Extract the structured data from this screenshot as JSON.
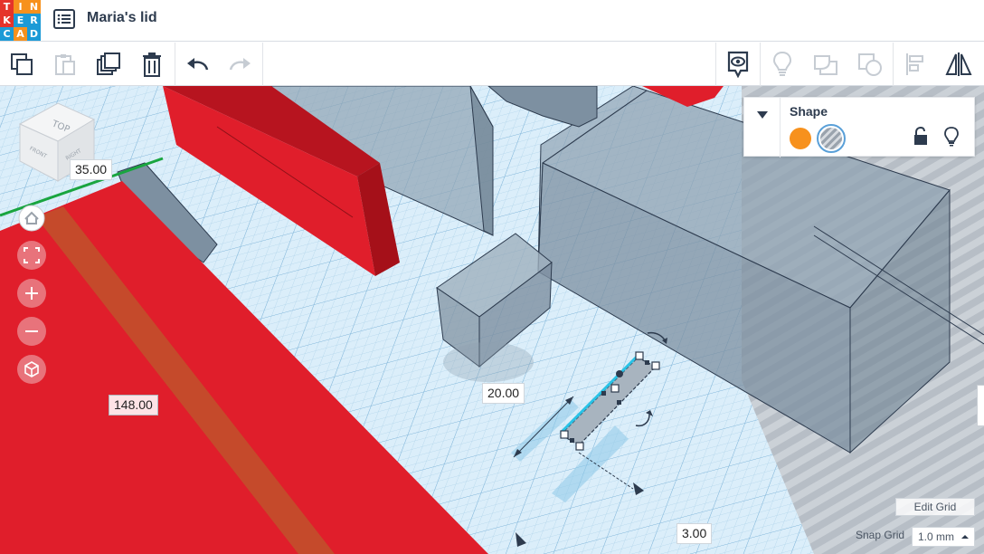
{
  "app": {
    "logo_letters": [
      "T",
      "I",
      "N",
      "K",
      "E",
      "R",
      "C",
      "A",
      "D"
    ],
    "logo_colors": [
      "#e5332a",
      "#f7911d",
      "#f7911d",
      "#e5332a",
      "#1c9ad6",
      "#1c9ad6",
      "#1c9ad6",
      "#f7911d",
      "#1c9ad6"
    ],
    "doc_title": "Maria's lid"
  },
  "toolbar": {
    "buttons": [
      {
        "name": "copy-icon"
      },
      {
        "name": "paste-icon"
      },
      {
        "name": "duplicate-icon"
      },
      {
        "name": "delete-icon"
      },
      {
        "name": "undo-icon"
      },
      {
        "name": "redo-icon"
      },
      {
        "name": "show-hide-icon"
      },
      {
        "name": "bulb-icon"
      },
      {
        "name": "group-icon"
      },
      {
        "name": "ungroup-icon"
      },
      {
        "name": "align-icon"
      },
      {
        "name": "mirror-icon"
      }
    ]
  },
  "view_cube": {
    "top": "TOP",
    "front": "FRONT",
    "right": "RIGHT"
  },
  "shape_panel": {
    "title": "Shape",
    "solid_color": "#f7911d",
    "hole_selected": true
  },
  "dimensions": {
    "d1": "35.00",
    "d2": "148.00",
    "d3": "20.00",
    "d4": "3.00"
  },
  "grid": {
    "edit_grid_label": "Edit Grid",
    "snap_grid_label": "Snap Grid",
    "snap_grid_value": "1.0 mm"
  },
  "colors": {
    "accent_red": "#e01e2b",
    "hole_gray": "#8fa2b2",
    "workplane": "#dbeefa",
    "nav_button": "#e8737b"
  }
}
